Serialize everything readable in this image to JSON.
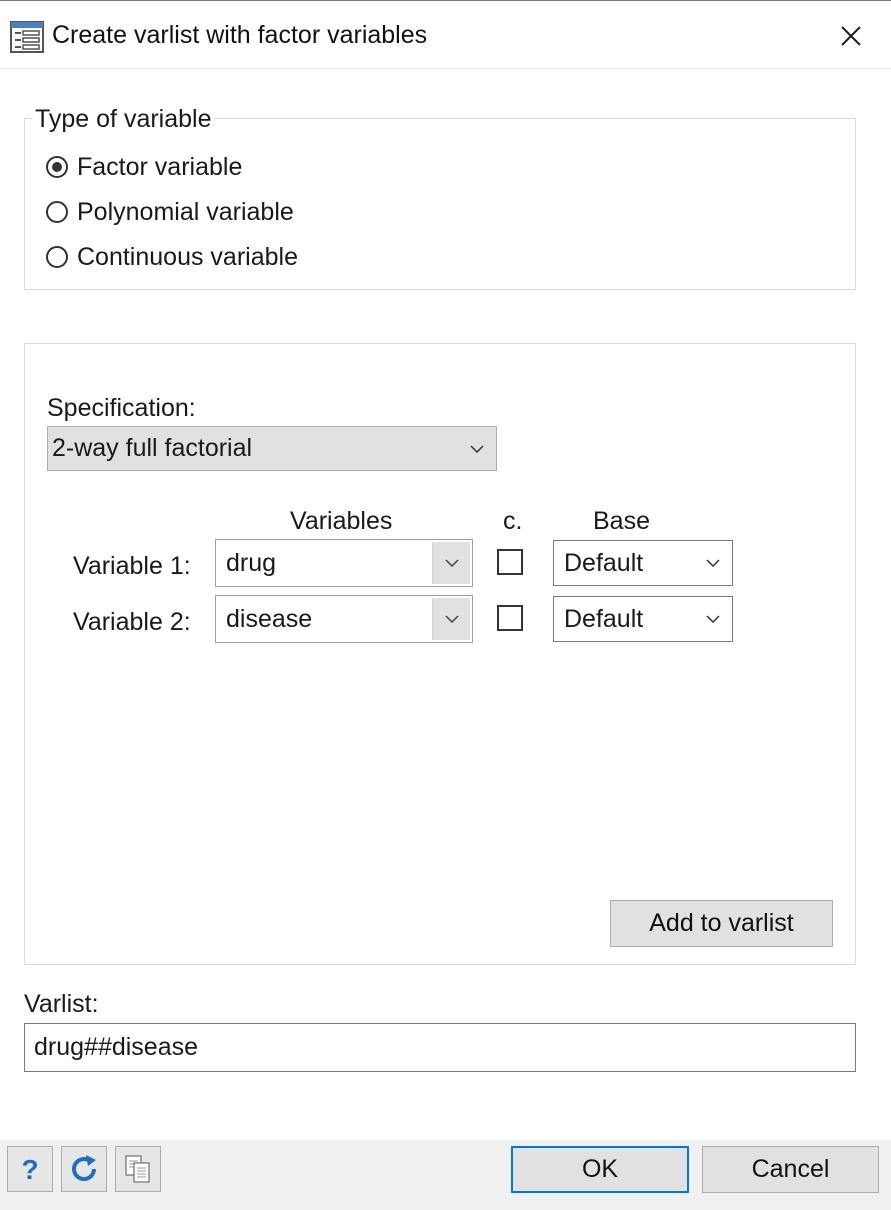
{
  "window": {
    "title": "Create varlist with factor variables"
  },
  "type_group": {
    "legend": "Type of variable",
    "options": [
      {
        "label": "Factor variable",
        "checked": true
      },
      {
        "label": "Polynomial variable",
        "checked": false
      },
      {
        "label": "Continuous variable",
        "checked": false
      }
    ]
  },
  "specification": {
    "label": "Specification:",
    "value": "2-way full factorial"
  },
  "columns": {
    "variables": "Variables",
    "continuous": "c.",
    "base": "Base"
  },
  "rows": [
    {
      "label": "Variable 1:",
      "variable": "drug",
      "continuous_checked": false,
      "base": "Default"
    },
    {
      "label": "Variable 2:",
      "variable": "disease",
      "continuous_checked": false,
      "base": "Default"
    }
  ],
  "add_button": "Add to varlist",
  "varlist": {
    "label": "Varlist:",
    "value": "drug##disease"
  },
  "footer": {
    "ok": "OK",
    "cancel": "Cancel"
  },
  "icons": {
    "app": "dialog-icon",
    "close": "close-icon",
    "help": "help-icon",
    "reset": "reset-icon",
    "copy": "copy-icon"
  },
  "colors": {
    "ok_border": "#0078d7",
    "icon_blue": "#1e6fc4"
  }
}
